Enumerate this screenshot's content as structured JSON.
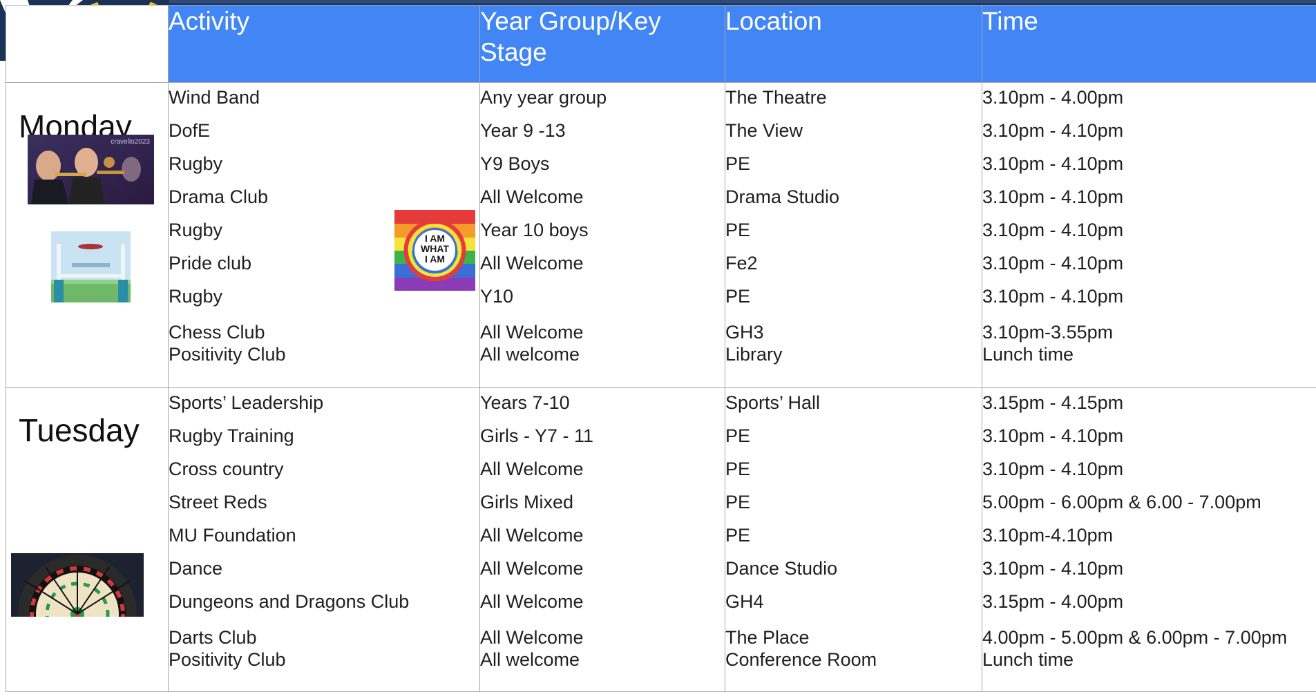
{
  "header": {
    "activity": "Activity",
    "year_group": "Year Group/Key Stage",
    "location": "Location",
    "time": "Time"
  },
  "days": [
    {
      "name": "Monday",
      "rows": [
        {
          "activity": "Wind Band",
          "year": "Any year group",
          "location": "The Theatre",
          "time": "3.10pm - 4.00pm"
        },
        {
          "activity": "DofE",
          "year": "Year 9 -13",
          "location": "The View",
          "time": "3.10pm - 4.10pm"
        },
        {
          "activity": "Rugby",
          "year": "Y9 Boys",
          "location": "PE",
          "time": "3.10pm - 4.10pm"
        },
        {
          "activity": "Drama Club",
          "year": "All Welcome",
          "location": "Drama Studio",
          "time": "3.10pm - 4.10pm"
        },
        {
          "activity": "Rugby",
          "year": "Year 10 boys",
          "location": "PE",
          "time": "3.10pm - 4.10pm"
        },
        {
          "activity": "Pride club",
          "year": "All Welcome",
          "location": "Fe2",
          "time": "3.10pm - 4.10pm"
        },
        {
          "activity": "Rugby",
          "year": "Y10",
          "location": "PE",
          "time": "3.10pm - 4.10pm"
        },
        {
          "activity": "Chess Club",
          "year": "All Welcome",
          "location": "GH3",
          "time": "3.10pm-3.55pm"
        },
        {
          "activity": "Positivity Club",
          "year": "All welcome",
          "location": "Library",
          "time": " Lunch time"
        }
      ]
    },
    {
      "name": "Tuesday",
      "rows": [
        {
          "activity": "Sports’ Leadership",
          "year": "Years 7-10",
          "location": "Sports’ Hall",
          "time": "3.15pm - 4.15pm"
        },
        {
          "activity": "Rugby Training",
          "year": "Girls - Y7 - 11",
          "location": "PE",
          "time": "3.10pm - 4.10pm"
        },
        {
          "activity": "Cross country",
          "year": "All Welcome",
          "location": "PE",
          "time": "3.10pm - 4.10pm"
        },
        {
          "activity": "Street Reds",
          "year": "Girls Mixed",
          "location": "PE",
          "time": "5.00pm - 6.00pm & 6.00 - 7.00pm"
        },
        {
          "activity": "MU Foundation",
          "year": "All Welcome",
          "location": "PE",
          "time": "3.10pm-4.10pm"
        },
        {
          "activity": "Dance",
          "year": "All Welcome",
          "location": "Dance Studio",
          "time": "3.10pm - 4.10pm"
        },
        {
          "activity": "Dungeons and Dragons Club",
          "year": "All Welcome",
          "location": "GH4",
          "time": "3.15pm - 4.00pm"
        },
        {
          "activity": "Darts Club",
          "year": "All Welcome",
          "location": "The Place",
          "time": "4.00pm - 5.00pm & 6.00pm - 7.00pm"
        },
        {
          "activity": "Positivity Club",
          "year": "All welcome",
          "location": "Conference Room",
          "time": "Lunch time"
        }
      ]
    }
  ],
  "images": {
    "band_watermark": "cravello2023",
    "pride_badge": [
      "I AM",
      "WHAT",
      "I AM"
    ]
  },
  "colors": {
    "header_bg": "#4285f4",
    "top_band": "#1b3257",
    "grid": "#a9a9a9"
  }
}
